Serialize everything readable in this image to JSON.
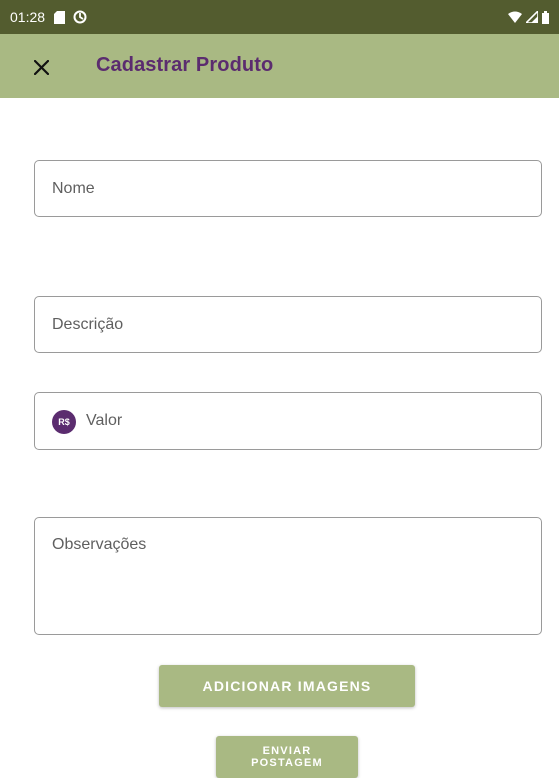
{
  "status_bar": {
    "time": "01:28",
    "left_icons": [
      "sd-card-icon",
      "sync-icon"
    ],
    "right_icons": [
      "wifi-icon",
      "signal-icon",
      "battery-icon"
    ]
  },
  "app_bar": {
    "close_icon": "close-icon",
    "title": "Cadastrar Produto"
  },
  "form": {
    "name_placeholder": "Nome",
    "description_placeholder": "Descrição",
    "valor_prefix": "R$",
    "valor_placeholder": "Valor",
    "observations_placeholder": "Observações"
  },
  "buttons": {
    "add_images": "ADICIONAR IMAGENS",
    "send_post": "ENVIAR POSTAGEM"
  },
  "colors": {
    "status_bar": "#535c2f",
    "app_bar": "#a9b983",
    "accent_purple": "#5b2c6f",
    "button": "#a9b983"
  }
}
